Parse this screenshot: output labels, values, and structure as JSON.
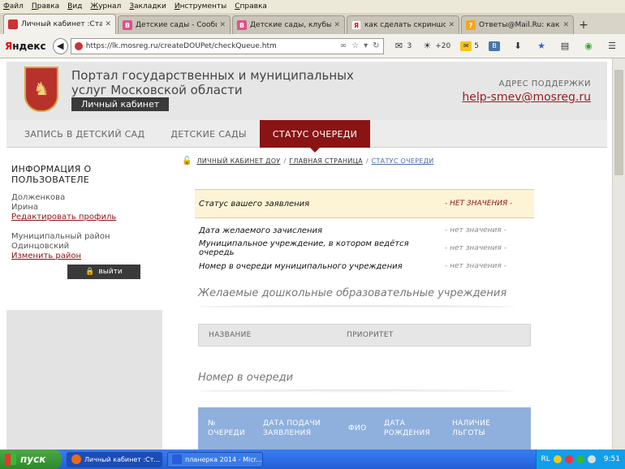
{
  "browser": {
    "menu": [
      "Файл",
      "Правка",
      "Вид",
      "Журнал",
      "Закладки",
      "Инструменты",
      "Справка"
    ],
    "tabs": [
      {
        "title": "Личный кабинет :Статус ...",
        "favicon_color": "#c33",
        "favicon_glyph": "",
        "icon": "mosreg-favicon"
      },
      {
        "title": "Детские сады - Сообще...",
        "favicon_color": "#e0508a",
        "favicon_glyph": "В",
        "icon": "vk-favicon"
      },
      {
        "title": "Детские сады, клубы, ц...",
        "favicon_color": "#e0508a",
        "favicon_glyph": "В",
        "icon": "vk-favicon"
      },
      {
        "title": "как сделать скриншот э...",
        "favicon_color": "#f0f0f0",
        "favicon_glyph": "Я",
        "icon": "yandex-favicon"
      },
      {
        "title": "Ответы@Mail.Ru: как сд...",
        "favicon_color": "#f5a623",
        "favicon_glyph": "?",
        "icon": "mailru-favicon"
      }
    ],
    "brand": {
      "first": "Я",
      "rest": "ндекс"
    },
    "url": "https://lk.mosreg.ru/createDOUPet/checkQueue.htm",
    "mail_count": "3",
    "weather": "+20",
    "notif_count": "5"
  },
  "site": {
    "portal_title": "Портал государственных и муниципальных услуг Московской области",
    "cabinet_label": "Личный кабинет",
    "support_label": "АДРЕС ПОДДЕРЖКИ",
    "support_email": "help-smev@mosreg.ru",
    "nav": [
      {
        "label": "ЗАПИСЬ В ДЕТСКИЙ САД",
        "active": false
      },
      {
        "label": "ДЕТСКИЕ САДЫ",
        "active": false
      },
      {
        "label": "СТАТУС ОЧЕРЕДИ",
        "active": true
      }
    ]
  },
  "sidebar": {
    "title_line1": "ИНФОРМАЦИЯ О",
    "title_line2": "ПОЛЬЗОВАТЕЛЕ",
    "surname": "Долженкова",
    "name": "Ирина",
    "edit_profile": "Редактировать профиль",
    "district_label": "Муниципальный район",
    "district": "Одинцовский",
    "change_district": "Изменить район",
    "logout": "выйти"
  },
  "breadcrumb": [
    "ЛИЧНЫЙ КАБИНЕТ ДОУ",
    "ГЛАВНАЯ СТРАНИЦА",
    "СТАТУС ОЧЕРЕДИ"
  ],
  "status": {
    "head_label": "Статус вашего заявления",
    "head_value": "- НЕТ ЗНАЧЕНИЯ -",
    "rows": [
      {
        "label": "Дата желаемого зачисления",
        "value": "- нет значения -"
      },
      {
        "label": "Муниципальное учреждение, в котором ведётся очередь",
        "value": "- нет значения -"
      },
      {
        "label": "Номер в очереди муниципального учреждения",
        "value": "- нет значения -"
      }
    ]
  },
  "institutions": {
    "title": "Желаемые дошкольные образовательные учреждения",
    "col_name": "НАЗВАНИЕ",
    "col_priority": "ПРИОРИТЕТ"
  },
  "queue": {
    "title": "Номер в очереди",
    "cols": [
      [
        "№",
        "ОЧЕРЕДИ"
      ],
      [
        "ДАТА ПОДАЧИ",
        "ЗАЯВЛЕНИЯ"
      ],
      [
        "ФИО",
        ""
      ],
      [
        "ДАТА",
        "РОЖДЕНИЯ"
      ],
      [
        "НАЛИЧИЕ",
        "ЛЬГОТЫ"
      ]
    ]
  },
  "taskbar": {
    "start": "пуск",
    "items": [
      {
        "label": "Личный кабинет :Ст...",
        "icon_color": "#e86a1a",
        "active": true
      },
      {
        "label": "планерка 2014 - Micr...",
        "icon_color": "#2a5bd8",
        "active": false
      }
    ],
    "lang": "RL",
    "time": "9:51"
  }
}
